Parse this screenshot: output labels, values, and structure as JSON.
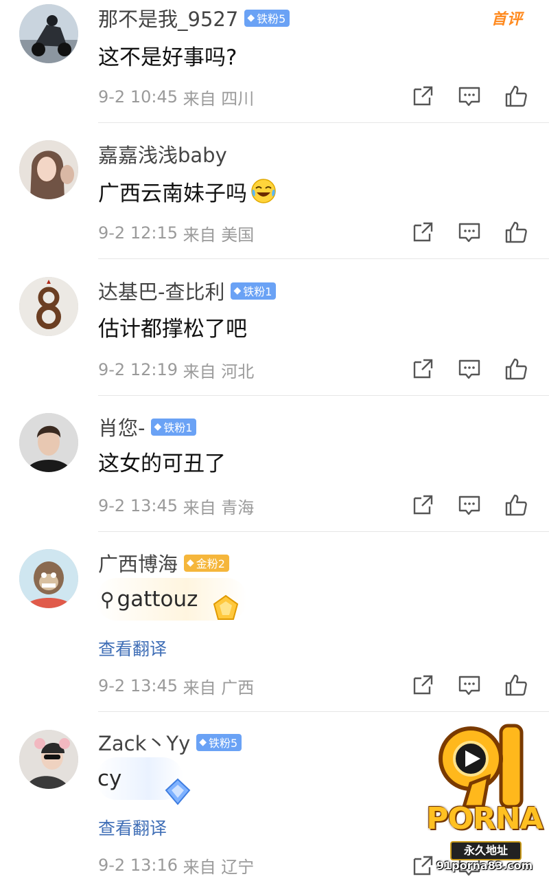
{
  "comments": [
    {
      "username": "那不是我_9527",
      "badge": "铁粉5",
      "badge_tier": "iron",
      "tag": "首评",
      "text": "这不是好事吗?",
      "time": "9-2 10:45",
      "from_label": "来自",
      "location": "四川"
    },
    {
      "username": "嘉嘉浅浅baby",
      "badge": "",
      "text": "广西云南妹子吗",
      "emoji": "laughing-crying-emoji",
      "time": "9-2 12:15",
      "from_label": "来自",
      "location": "美国"
    },
    {
      "username": "达基巴-查比利",
      "badge": "铁粉1",
      "badge_tier": "iron",
      "text": "估计都撑松了吧",
      "time": "9-2 12:19",
      "from_label": "来自",
      "location": "河北"
    },
    {
      "username": "肖您-",
      "badge": "铁粉1",
      "badge_tier": "iron",
      "text": "这女的可丑了",
      "time": "9-2 13:45",
      "from_label": "来自",
      "location": "青海"
    },
    {
      "username": "广西博海",
      "badge": "金粉2",
      "badge_tier": "gold",
      "text": "gattouz",
      "search_icon": "search-icon",
      "translate": "查看翻译",
      "time": "9-2 13:45",
      "from_label": "来自",
      "location": "广西"
    },
    {
      "username": "Zack丶Yy",
      "badge": "铁粉5",
      "badge_tier": "iron",
      "text": "cy",
      "translate": "查看翻译",
      "time": "9-2 13:16",
      "from_label": "来自",
      "location": "辽宁"
    }
  ],
  "watermark": {
    "number": "91",
    "brand": "PORNA",
    "subtitle": "永久地址",
    "url": "91porna83.com"
  },
  "colors": {
    "iron_badge": "#6aa2f5",
    "gold_badge": "#f5b63b",
    "first_tag": "#ff8a1f",
    "meta_text": "#9a9a9a",
    "link": "#3f6eb6"
  },
  "icons": [
    "share-icon",
    "comment-icon",
    "like-icon"
  ]
}
